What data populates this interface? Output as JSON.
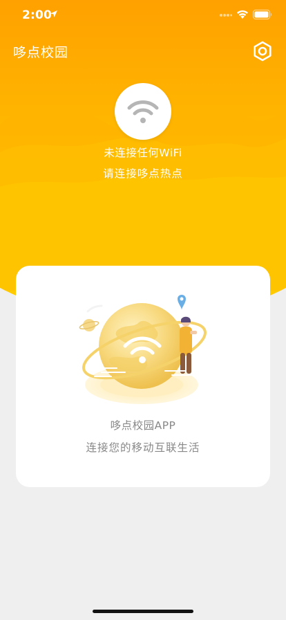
{
  "status_bar": {
    "time": "2:00"
  },
  "nav": {
    "title": "哆点校园",
    "settings_icon": "gear-icon"
  },
  "connection": {
    "icon": "wifi-icon",
    "status": "未连接任何WiFi",
    "hint": "请连接哆点热点"
  },
  "card": {
    "app_name": "哆点校园APP",
    "slogan": "连接您的移动互联生活"
  },
  "colors": {
    "accent_orange": "#ff9c00",
    "accent_yellow": "#ffcc00",
    "text_gray": "#888888",
    "background": "#efefef"
  }
}
